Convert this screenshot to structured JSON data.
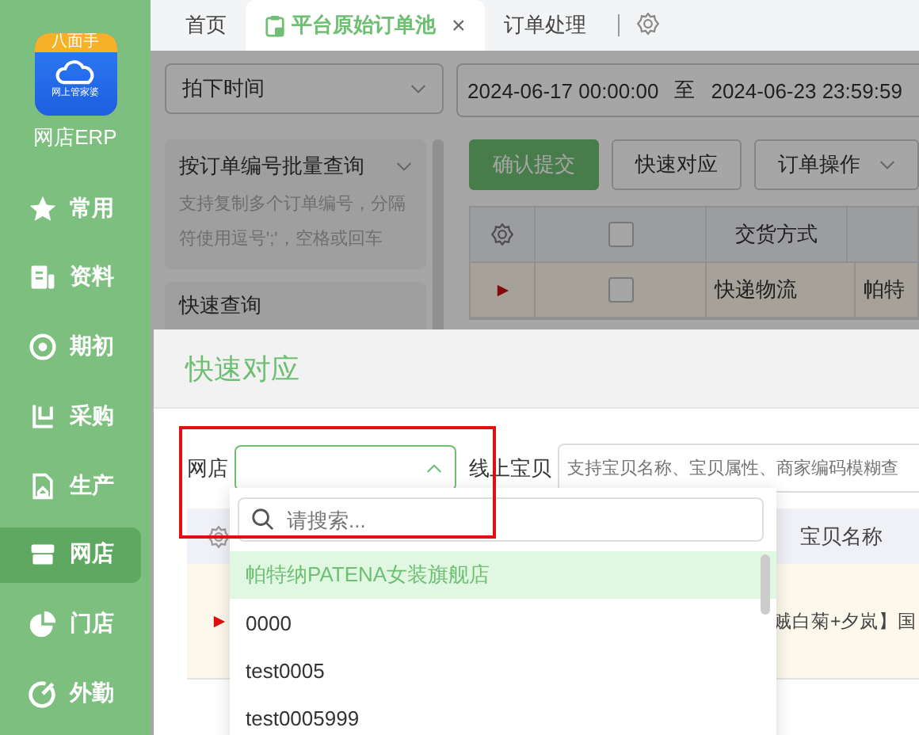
{
  "sidebar": {
    "logo": {
      "badge": "八面手",
      "caption": "网上管家婆"
    },
    "app_name": "网店ERP",
    "items": [
      {
        "label": "常用",
        "selected": false
      },
      {
        "label": "资料",
        "selected": false
      },
      {
        "label": "期初",
        "selected": false
      },
      {
        "label": "采购",
        "selected": false
      },
      {
        "label": "生产",
        "selected": false
      },
      {
        "label": "网店",
        "selected": true
      },
      {
        "label": "门店",
        "selected": false
      },
      {
        "label": "外勤",
        "selected": false
      }
    ]
  },
  "tabs": [
    {
      "label": "首页",
      "selected": false,
      "closable": false
    },
    {
      "label": "平台原始订单池",
      "selected": true,
      "closable": true,
      "close": "×"
    },
    {
      "label": "订单处理",
      "selected": false,
      "closable": false
    }
  ],
  "filter": {
    "time_type": "拍下时间",
    "start": "2024-06-17 00:00:00",
    "separator": "至",
    "end": "2024-06-23 23:59:59"
  },
  "batch_query": {
    "title": "按订单编号批量查询",
    "placeholder": "支持复制多个订单编号，分隔符使用逗号';'，空格或回车"
  },
  "quick_query": {
    "title": "快速查询"
  },
  "toolbar": [
    {
      "label": "确认提交",
      "kind": "primary"
    },
    {
      "label": "快速对应",
      "kind": "plain"
    },
    {
      "label": "订单操作",
      "kind": "menu"
    }
  ],
  "orders": {
    "all_checked": false,
    "columns": [
      "交货方式"
    ],
    "rows": [
      {
        "checked": false,
        "delivery": "快递物流",
        "column_4": "帕特"
      }
    ]
  },
  "dialog": {
    "title": "快速对应",
    "shop_label": "网店",
    "item_label": "线上宝贝",
    "item_placeholder": "支持宝贝名称、宝贝属性、商家编码模糊查",
    "dropdown": {
      "search_placeholder": "请搜索...",
      "options": [
        {
          "label": "帕特纳PATENA女装旗舰店",
          "selected": true
        },
        {
          "label": "0000",
          "selected": false
        },
        {
          "label": "test0005",
          "selected": false
        },
        {
          "label": "test0005999",
          "selected": false
        }
      ]
    },
    "table": {
      "column": "宝贝名称",
      "rows": [
        {
          "name": "贼白菊+夕岚】国",
          "flagged": true
        }
      ]
    }
  }
}
